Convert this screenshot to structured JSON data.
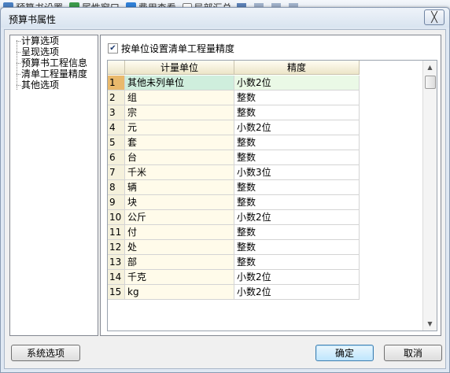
{
  "background_toolbar": {
    "items": [
      "预算书设置",
      "属性窗口",
      "费用查看",
      "局部汇总"
    ]
  },
  "dialog": {
    "title": "预算书属性",
    "close_glyph": "╳"
  },
  "tree": {
    "items": [
      "计算选项",
      "呈现选项",
      "预算书工程信息",
      "清单工程量精度",
      "其他选项"
    ]
  },
  "panel": {
    "checkbox_label": "按单位设置清单工程量精度",
    "checkbox_checked": true,
    "grid": {
      "headers": [
        "计量单位",
        "精度"
      ],
      "rows": [
        {
          "n": "1",
          "unit": "其他未列单位",
          "precision": "小数2位"
        },
        {
          "n": "2",
          "unit": "组",
          "precision": "整数"
        },
        {
          "n": "3",
          "unit": "宗",
          "precision": "整数"
        },
        {
          "n": "4",
          "unit": "元",
          "precision": "小数2位"
        },
        {
          "n": "5",
          "unit": "套",
          "precision": "整数"
        },
        {
          "n": "6",
          "unit": "台",
          "precision": "整数"
        },
        {
          "n": "7",
          "unit": "千米",
          "precision": "小数3位"
        },
        {
          "n": "8",
          "unit": "辆",
          "precision": "整数"
        },
        {
          "n": "9",
          "unit": "块",
          "precision": "整数"
        },
        {
          "n": "10",
          "unit": "公斤",
          "precision": "小数2位"
        },
        {
          "n": "11",
          "unit": "付",
          "precision": "整数"
        },
        {
          "n": "12",
          "unit": "处",
          "precision": "整数"
        },
        {
          "n": "13",
          "unit": "部",
          "precision": "整数"
        },
        {
          "n": "14",
          "unit": "千克",
          "precision": "小数2位"
        },
        {
          "n": "15",
          "unit": "kg",
          "precision": "小数2位"
        }
      ]
    }
  },
  "buttons": {
    "system_options": "系统选项",
    "ok": "确定",
    "cancel": "取消"
  },
  "colors": {
    "selected_row_num": "#e9b96c",
    "selected_row_unit": "#cfeedd",
    "default_button_border": "#3c7fb1"
  }
}
